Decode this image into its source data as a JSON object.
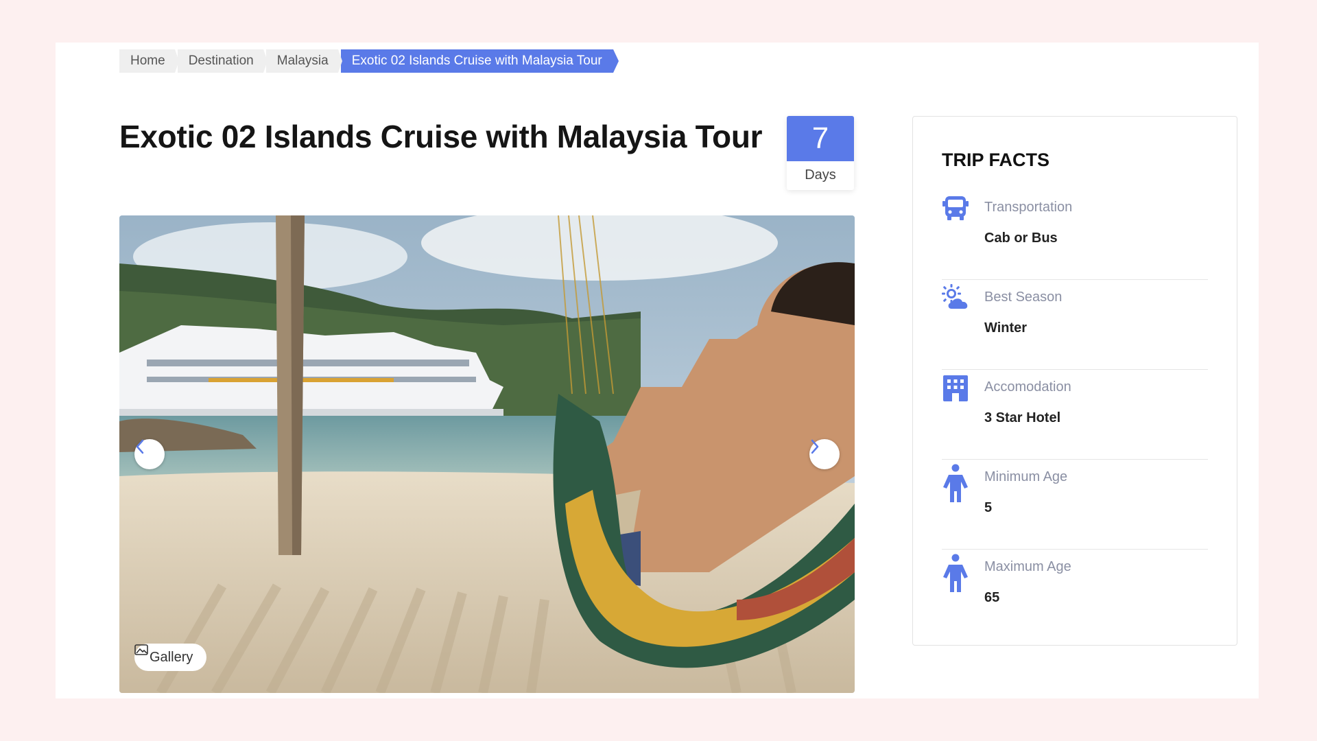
{
  "breadcrumb": {
    "items": [
      "Home",
      "Destination",
      "Malaysia"
    ],
    "current": "Exotic 02 Islands Cruise with Malaysia Tour"
  },
  "tour": {
    "title": "Exotic 02 Islands Cruise with Malaysia Tour",
    "duration_value": "7",
    "duration_unit": "Days"
  },
  "hero": {
    "gallery_label": "Gallery",
    "prev_icon": "chevron-left-icon",
    "next_icon": "chevron-right-icon"
  },
  "trip_facts": {
    "title": "TRIP FACTS",
    "items": [
      {
        "icon": "bus-icon",
        "label": "Transportation",
        "value": "Cab or Bus"
      },
      {
        "icon": "sun-cloud-icon",
        "label": "Best Season",
        "value": "Winter"
      },
      {
        "icon": "hotel-icon",
        "label": "Accomodation",
        "value": "3 Star Hotel"
      },
      {
        "icon": "person-icon",
        "label": "Minimum Age",
        "value": "5"
      },
      {
        "icon": "person-icon",
        "label": "Maximum Age",
        "value": "65"
      }
    ]
  },
  "colors": {
    "accent": "#5a7ae8",
    "page_background": "#fdf0f0",
    "muted_label": "#8a8fa3"
  }
}
